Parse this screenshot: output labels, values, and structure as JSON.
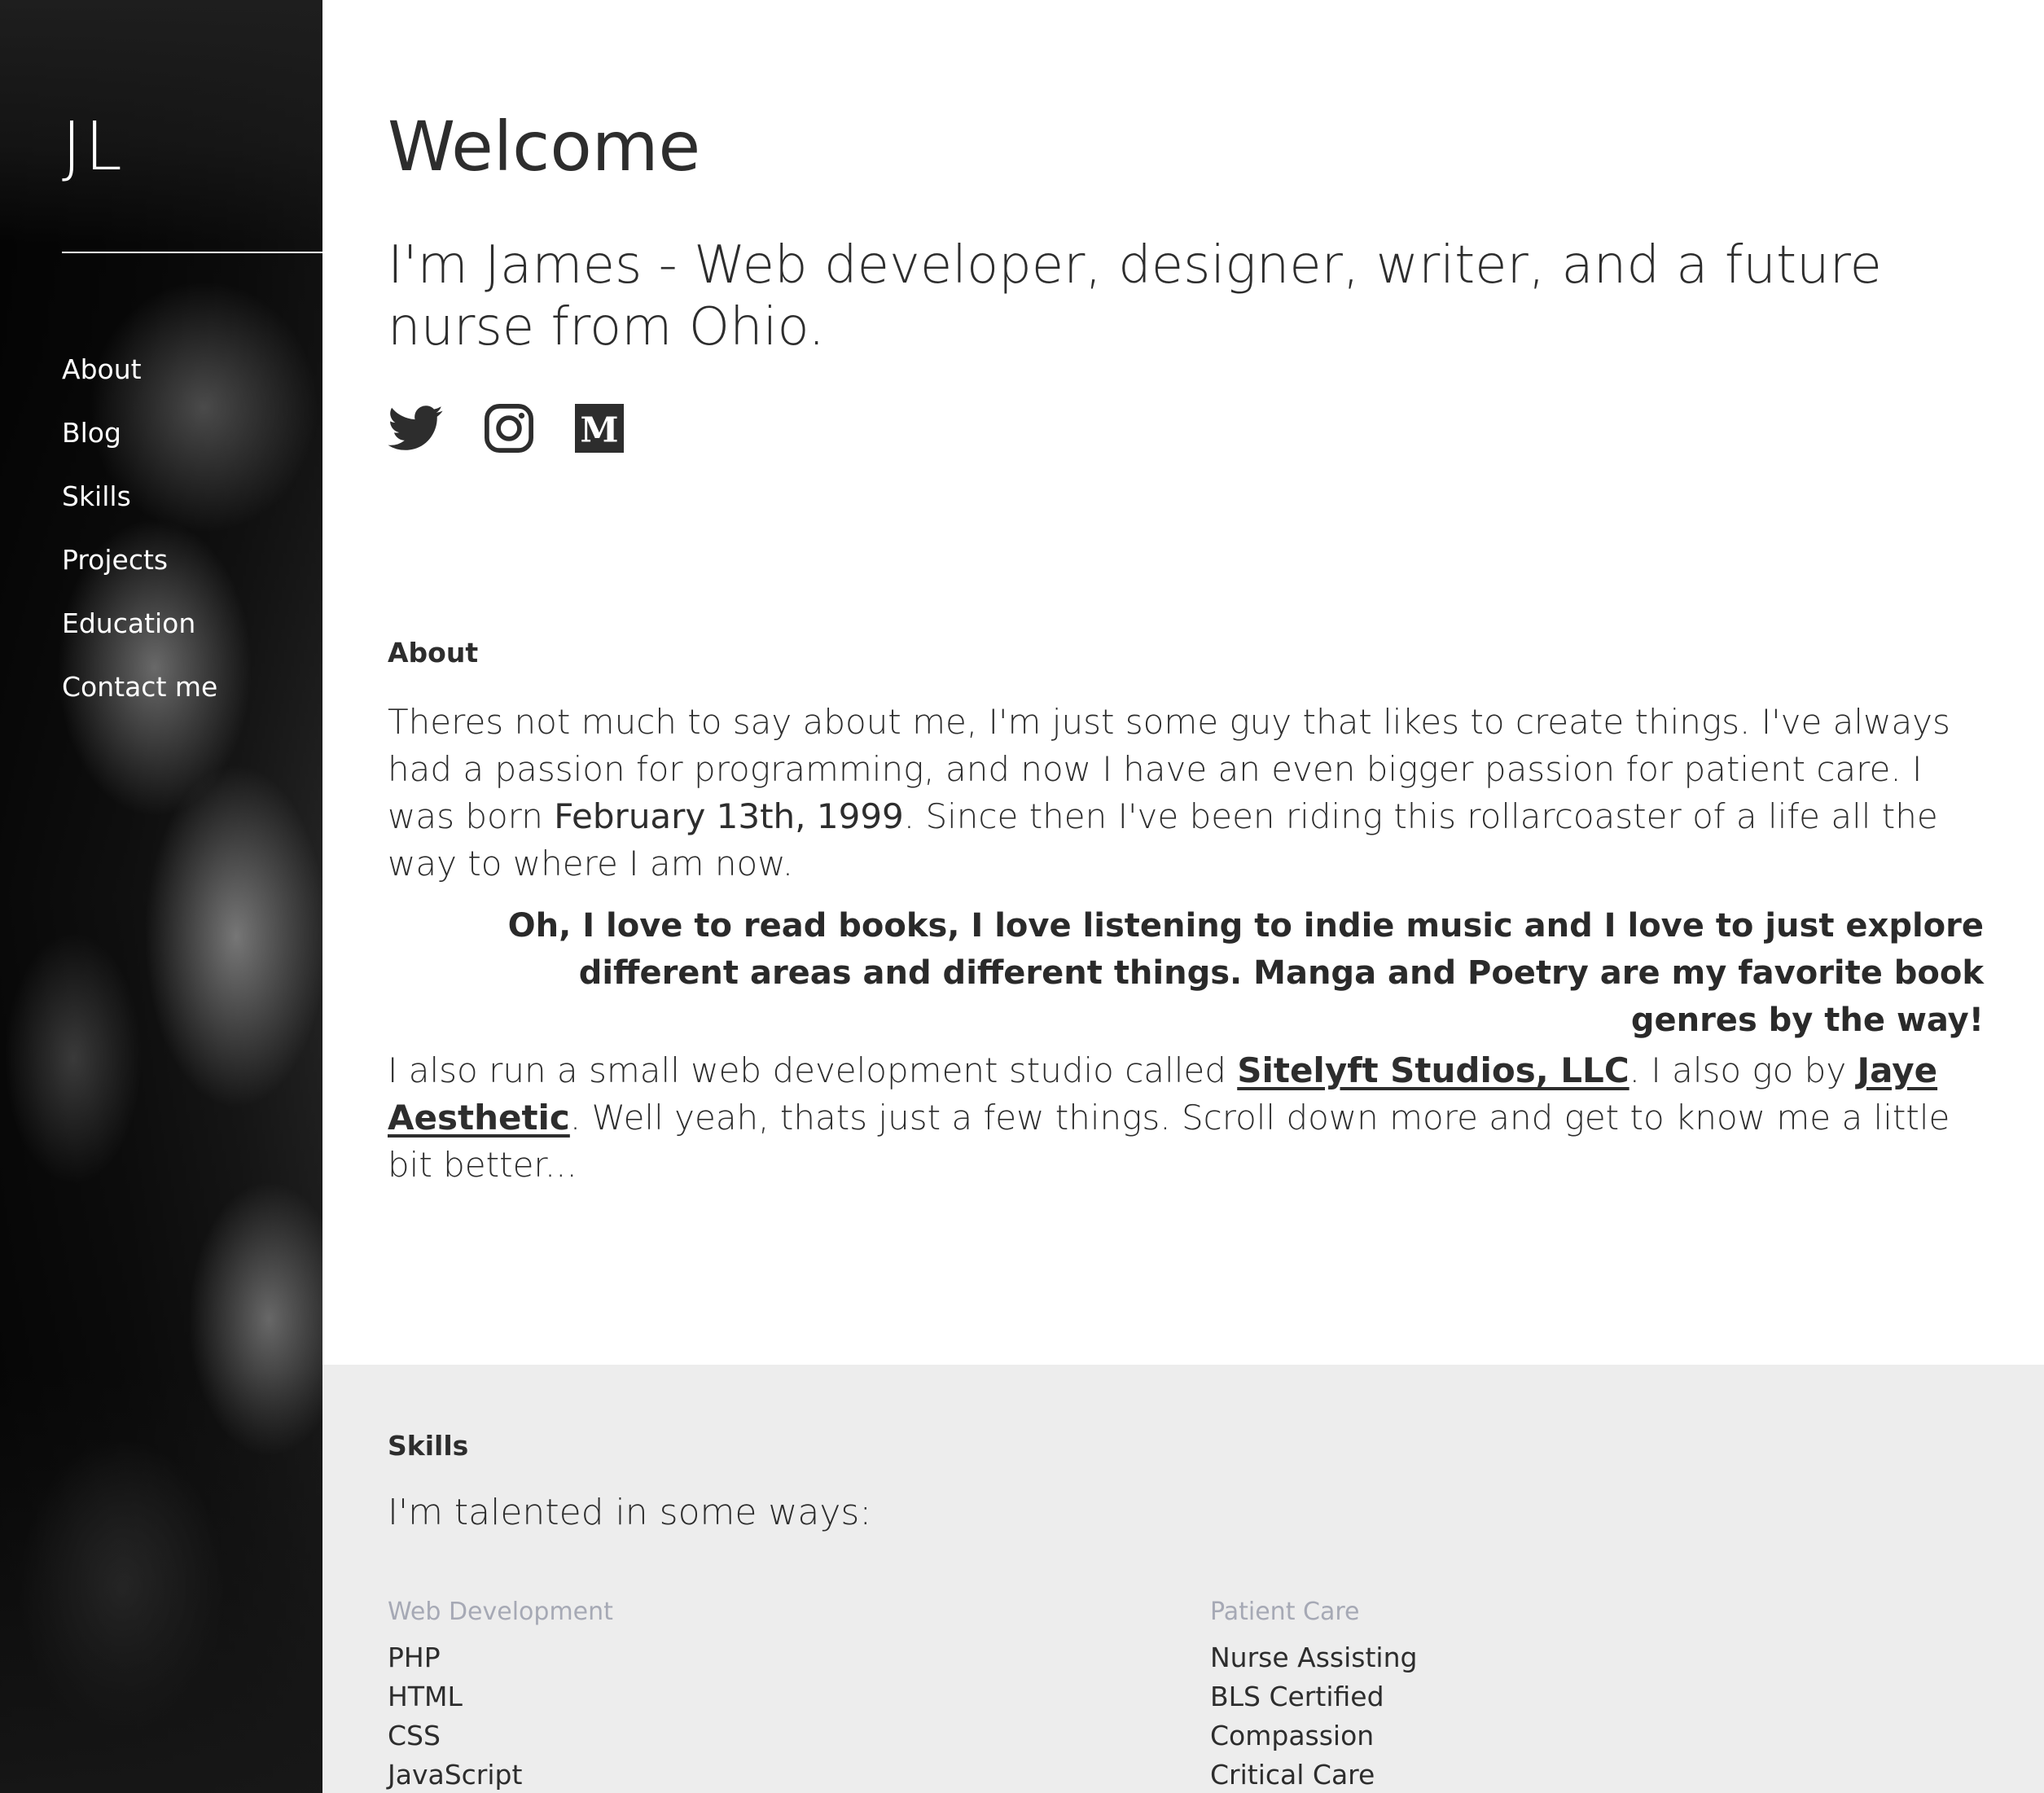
{
  "sidebar": {
    "logo": "JL",
    "nav": [
      "About",
      "Blog",
      "Skills",
      "Projects",
      "Education",
      "Contact me"
    ]
  },
  "header": {
    "title": "Welcome",
    "intro": "I'm James - Web developer, designer, writer, and a future nurse from Ohio."
  },
  "social": [
    {
      "name": "twitter",
      "icon": "twitter-bird-icon"
    },
    {
      "name": "instagram",
      "icon": "instagram-camera-icon"
    },
    {
      "name": "medium",
      "icon": "medium-m-icon",
      "glyph": "M"
    }
  ],
  "about": {
    "label": "About",
    "p1_before": "Theres not much to say about me, I'm just some guy that likes to create things. I've always had a passion for programming, and now I have an even bigger passion for patient care. I was born ",
    "birthdate": "February 13th, 1999",
    "p1_after": ". Since then I've been riding this rollarcoaster of a life all the way to where I am now.",
    "quote": "Oh, I love to read books, I love listening to indie music and I love to just explore different areas and different things. Manga and Poetry are my favorite book genres by the way!",
    "p2_before": "I also run a small web development studio called ",
    "studio_link": "Sitelyft Studios, LLC",
    "p2_middle": ". I also go by ",
    "alias_link": "Jaye Aesthetic",
    "p2_after": ". Well yeah, thats just a few things. Scroll down more and get to know me a little bit better..."
  },
  "skills": {
    "label": "Skills",
    "heading": "I'm talented in some ways:",
    "web_title": "Web Development",
    "web_items": [
      "PHP",
      "HTML",
      "CSS",
      "JavaScript"
    ],
    "care_title": "Patient Care",
    "care_items": [
      "Nurse Assisting",
      "BLS Certified",
      "Compassion",
      "Critical Care"
    ]
  },
  "colors": {
    "text": "#2d2d2d",
    "skills_bg": "#ededed",
    "skill_category": "#a6a9b5"
  }
}
